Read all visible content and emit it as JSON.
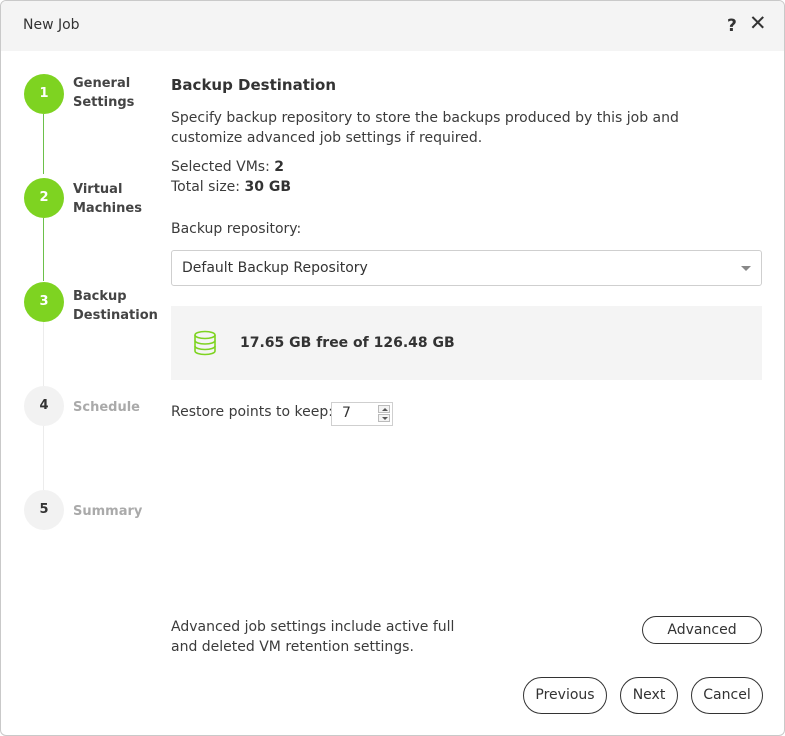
{
  "window": {
    "title": "New Job",
    "help_glyph": "?",
    "close_glyph": "✕"
  },
  "steps": [
    {
      "number": "1",
      "label": "General\nSettings",
      "state": "done"
    },
    {
      "number": "2",
      "label": "Virtual\nMachines",
      "state": "done"
    },
    {
      "number": "3",
      "label": "Backup\nDestination",
      "state": "current"
    },
    {
      "number": "4",
      "label": "Schedule",
      "state": "todo"
    },
    {
      "number": "5",
      "label": "Summary",
      "state": "todo"
    }
  ],
  "main": {
    "heading": "Backup Destination",
    "description": "Specify backup repository to store the backups produced by this job and customize advanced job settings if required.",
    "selected_vms_label": "Selected VMs:",
    "selected_vms_value": "2",
    "total_size_label": "Total size:",
    "total_size_value": "30 GB",
    "repository_label": "Backup repository:",
    "repository_selected": "Default Backup Repository",
    "storage_text": "17.65 GB free of 126.48 GB",
    "restore_points_label": "Restore points to keep:",
    "restore_points_value": "7",
    "advanced_note": "Advanced job settings include active full and deleted VM retention settings."
  },
  "buttons": {
    "advanced": "Advanced",
    "previous": "Previous",
    "next": "Next",
    "cancel": "Cancel"
  },
  "colors": {
    "accent_green": "#7ed321"
  }
}
